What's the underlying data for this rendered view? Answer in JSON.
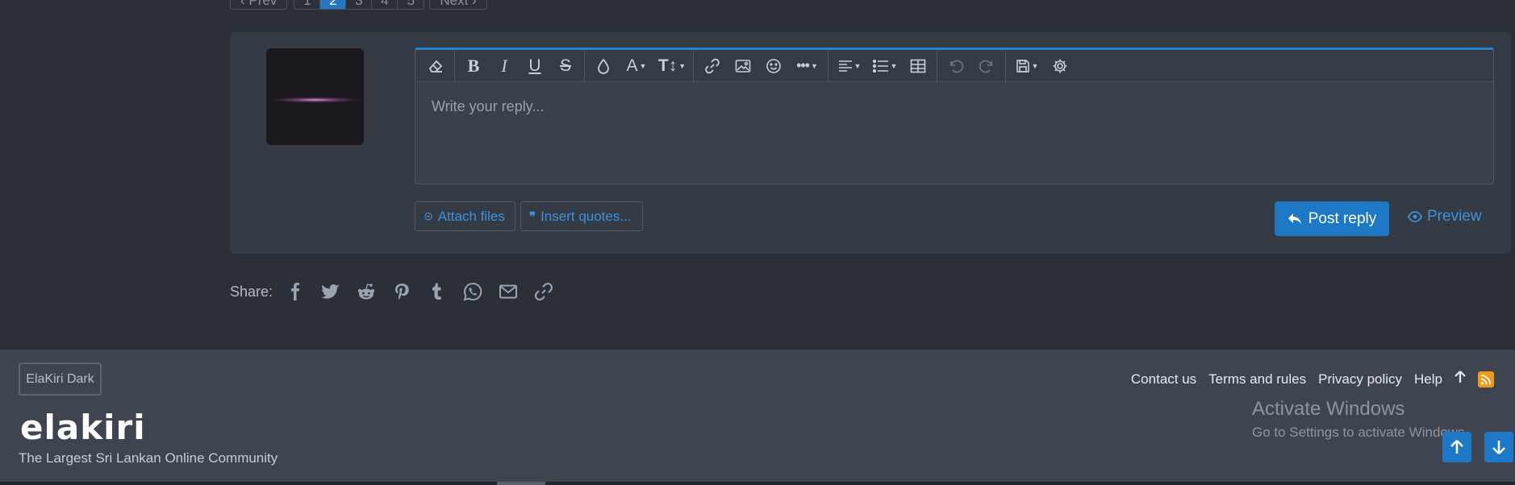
{
  "pagination": {
    "prev": "‹ Prev",
    "pages": [
      "1",
      "2",
      "3",
      "4",
      "5"
    ],
    "current": "2",
    "next": "Next ›"
  },
  "editor": {
    "placeholder": "Write your reply...",
    "toolbar": [
      "eraser-icon",
      "bold-icon",
      "italic-icon",
      "underline-icon",
      "strikethrough-icon",
      "text-color-icon",
      "font-family-icon",
      "font-size-icon",
      "link-icon",
      "image-icon",
      "smilie-icon",
      "more-icon",
      "align-icon",
      "list-icon",
      "table-icon",
      "undo-icon",
      "redo-icon",
      "drafts-icon",
      "settings-icon"
    ]
  },
  "actions": {
    "attach": "Attach files",
    "quotes": "Insert quotes...",
    "post": "Post reply",
    "preview": "Preview"
  },
  "share": {
    "label": "Share:",
    "icons": [
      "facebook-icon",
      "twitter-icon",
      "reddit-icon",
      "pinterest-icon",
      "tumblr-icon",
      "whatsapp-icon",
      "email-icon",
      "link-icon"
    ]
  },
  "footer": {
    "style": "ElaKiri Dark",
    "logo": "elakiri",
    "tagline": "The Largest Sri Lankan Online Community",
    "links": [
      "Contact us",
      "Terms and rules",
      "Privacy policy",
      "Help"
    ],
    "windows_title": "Activate Windows",
    "windows_sub": "Go to Settings to activate Windows."
  },
  "colors": {
    "accent": "#1d79c5",
    "link": "#3b92e0",
    "rss": "#f09a1a"
  }
}
